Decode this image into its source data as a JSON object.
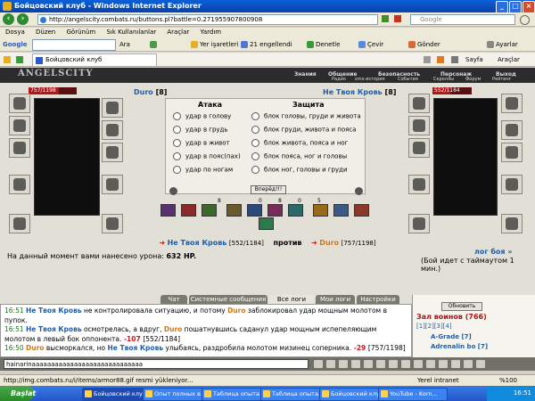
{
  "window": {
    "title": "Бойцовский клуб - Windows Internet Explorer"
  },
  "address": {
    "url": "http://angelscity.combats.ru/buttons.pl?battle=0.271955907800908",
    "search_placeholder": "Google"
  },
  "menu": [
    "Dosya",
    "Düzen",
    "Görünüm",
    "Sık Kullanılanlar",
    "Araçlar",
    "Yardım"
  ],
  "google_toolbar": {
    "search": "Google",
    "go": "Git",
    "search_btn": "Ara",
    "bookmarks": "Yer işaretleri",
    "tools": "Ayarlar",
    "blocked": "21 engellendi",
    "check": "Denetle",
    "translate": "Çevir",
    "send": "Gönder",
    "settings": "Ayarlar"
  },
  "tab": {
    "title": "Бойцовский клуб"
  },
  "tabbar_right": {
    "page": "Sayfa",
    "tools": "Araçlar"
  },
  "game": {
    "logo": "ANGELSCITY",
    "topnav": [
      "Знания",
      "Общение",
      "Безопасность",
      "Персонаж",
      "Выход"
    ],
    "subnav": [
      "Радио",
      "smx-история",
      "События",
      "Скроллы",
      "Форум",
      "Рейтинг"
    ],
    "player": {
      "name": "Duro",
      "level": "[8]",
      "hp": "757/1198",
      "hp_fraction": 0.63
    },
    "enemy": {
      "name": "Не Твоя Кровь",
      "level": "[8]",
      "hp": "552/1184",
      "hp_fraction": 0.47
    },
    "attack_header": "Атака",
    "defense_header": "Защита",
    "attacks": [
      "удар в голову",
      "удар в грудь",
      "удар в живот",
      "удар в пояс(пах)",
      "удар по ногам"
    ],
    "defenses": [
      "блок головы, груди и живота",
      "блок груди, живота и пояса",
      "блок живота, пояса и ног",
      "блок пояса, ног и головы",
      "блок ног, головы и груди"
    ],
    "forward_btn": "Вперёд!!!",
    "counters": [
      "8",
      "0",
      "8",
      "0",
      "5"
    ],
    "battle_line": {
      "left_name": "Не Твоя Кровь",
      "left_hp": "[552/1184]",
      "vs": "против",
      "right_name": "Duro",
      "right_hp": "[757/1198]"
    },
    "damage_text": "На данный момент вами нанесено урона:",
    "damage_value": "632 HP.",
    "log_link": "лог боя »",
    "timeout": "(Бой идет с таймаутом 1 мин.)"
  },
  "chat_tabs": [
    "Чат",
    "Системные сообщения",
    "Все логи",
    "Мои логи",
    "Настройки"
  ],
  "chat": [
    {
      "time": "16:51",
      "actor": "Не Твоя Кровь",
      "text": " не контролировала ситуацию, и потому ",
      "name2": "Duro",
      "text2": " заблокировал удар мощным молотом в пупок."
    },
    {
      "time": "16:51",
      "actor": "Не Твоя Кровь",
      "text": " осмотрелась, а вдруг, ",
      "name2": "Duro",
      "text2": " пошатнувшись саданул удар мощным испепеляющим молотом в левый бок оппонента.",
      "dmg": " -107 ",
      "hp": "[552/1184]"
    },
    {
      "time": "16:50",
      "actor": "Duro",
      "text": " высморкался, но ",
      "name2": "Не Твоя Кровь",
      "text2": " улыбаясь, раздробила молотом мизинец соперника.",
      "dmg": " -29 ",
      "hp": "[757/1198]"
    }
  ],
  "right_panel": {
    "update_btn": "Обновить",
    "room": "Зал воинов (766)",
    "pages": "[1][2][3][4]",
    "users": [
      "A-Grade [7]",
      "Adrenalin bo [7]"
    ]
  },
  "chat_input": "hainarinaaaaaaaaaaaaaaaaaaaaaaaaaaaaa",
  "status": {
    "text": "http://img.combats.ru/i/items/armor88.gif resmi yükleniyor...",
    "zone": "Yerel intranet",
    "zoom": "%100"
  },
  "taskbar": {
    "start": "Başlat",
    "tasks": [
      "Бойцовский клу...",
      "Опыт полных в...",
      "Таблица опыта...",
      "Таблица опыта...",
      "Бойцовский клу...",
      "YouTube - Korn..."
    ],
    "clock": "16:51"
  }
}
